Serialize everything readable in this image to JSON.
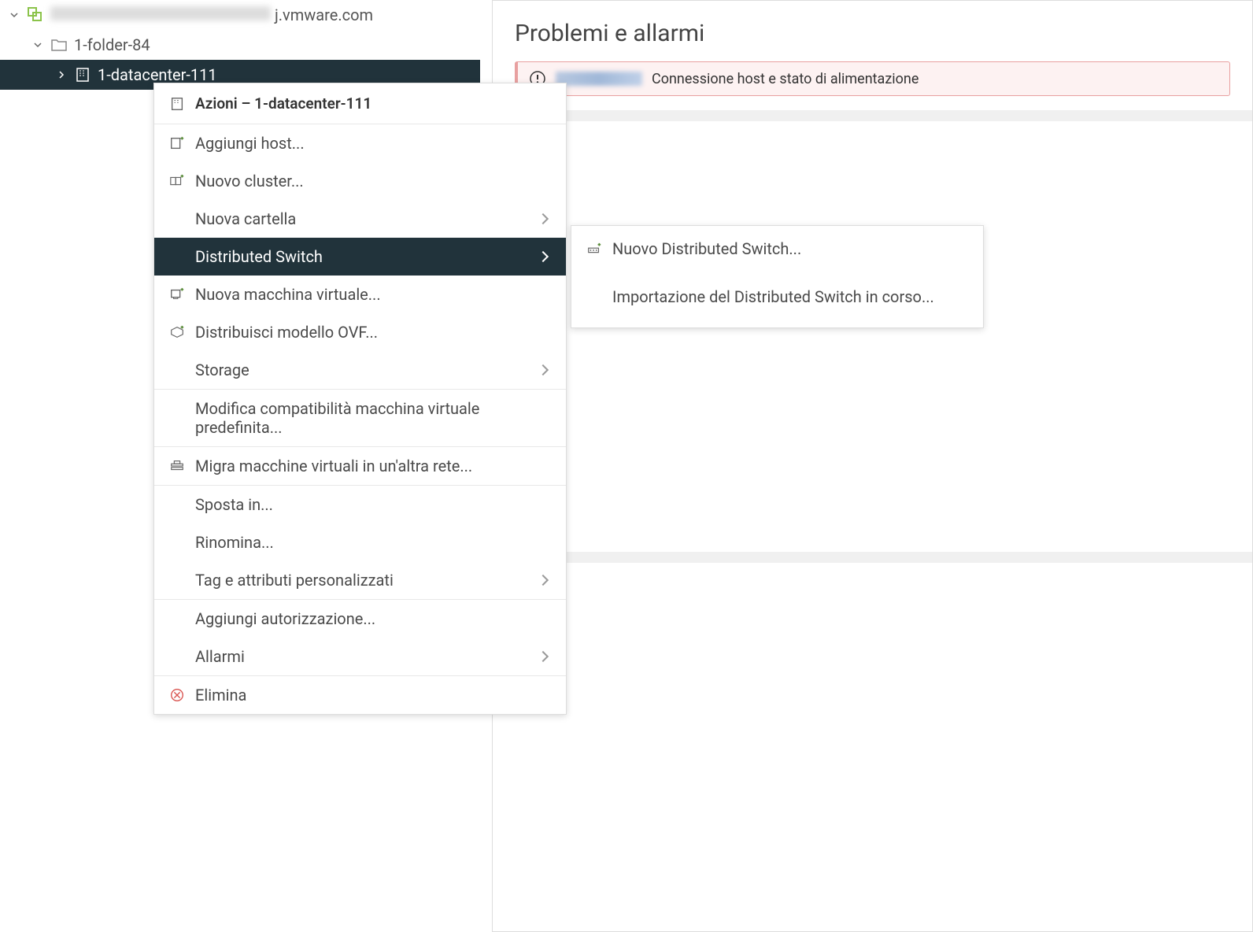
{
  "tree": {
    "root": {
      "label_suffix": "j.vmware.com"
    },
    "folder": {
      "label": "1-folder-84"
    },
    "datacenter": {
      "label": "1-datacenter-111"
    }
  },
  "contextMenu": {
    "header": "Azioni – 1-datacenter-111",
    "items": {
      "addHost": "Aggiungi host...",
      "newCluster": "Nuovo cluster...",
      "newFolder": "Nuova cartella",
      "distributedSwitch": "Distributed Switch",
      "newVm": "Nuova macchina virtuale...",
      "deployOvf": "Distribuisci modello OVF...",
      "storage": "Storage",
      "modifyCompat": "Modifica compatibilità macchina virtuale predefinita...",
      "migrateVm": "Migra macchine virtuali in un'altra rete...",
      "moveTo": "Sposta in...",
      "rename": "Rinomina...",
      "tagsAttrs": "Tag e attributi personalizzati",
      "addPermission": "Aggiungi autorizzazione...",
      "alarms": "Allarmi",
      "delete": "Elimina"
    }
  },
  "submenu": {
    "newDvs": "Nuovo Distributed Switch...",
    "importDvs": "Importazione del Distributed Switch in corso..."
  },
  "rightPanel": {
    "title": "Problemi e allarmi",
    "alertText": "Connessione host e stato di alimentazione"
  }
}
